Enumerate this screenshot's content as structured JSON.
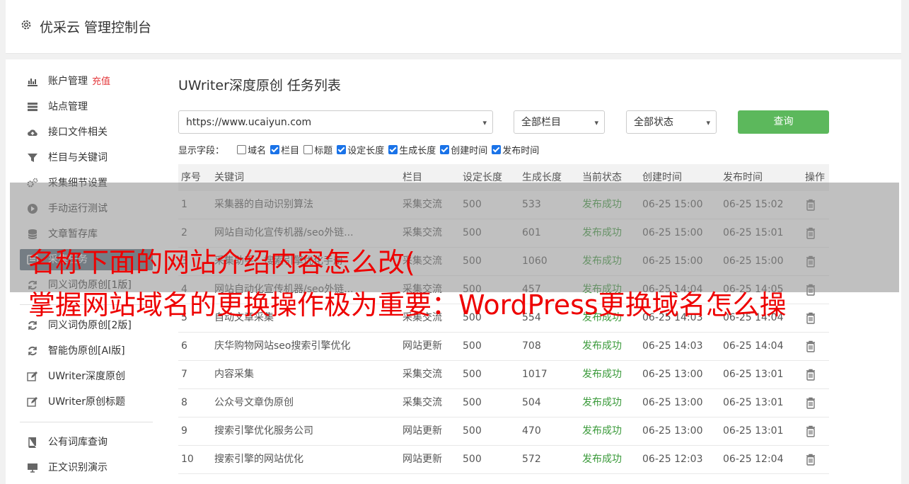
{
  "header": {
    "title": "优采云 管理控制台",
    "icon": "gear-icon"
  },
  "sidebar": {
    "items": [
      {
        "label": "账户管理",
        "extra": "充值",
        "icon": "bar-chart-icon"
      },
      {
        "label": "站点管理",
        "icon": "server-icon"
      },
      {
        "label": "接口文件相关",
        "icon": "cloud-upload-icon"
      },
      {
        "label": "栏目与关键词",
        "icon": "filter-icon"
      },
      {
        "label": "采集细节设置",
        "icon": "gears-icon"
      },
      {
        "label": "手动运行测试",
        "icon": "play-circle-icon"
      },
      {
        "label": "文章暂存库",
        "icon": "database-icon"
      },
      {
        "label": "采集任务",
        "icon": "list-icon",
        "active": true
      },
      {
        "label": "同义词伪原创[1版]",
        "icon": "refresh-icon"
      },
      {
        "label": "同义词伪原创[2版]",
        "icon": "refresh-icon"
      },
      {
        "label": "智能伪原创[AI版]",
        "icon": "refresh-icon"
      },
      {
        "label": "UWriter深度原创",
        "icon": "edit-icon"
      },
      {
        "label": "UWriter原创标题",
        "icon": "edit-icon"
      },
      {
        "label": "公有词库查询",
        "icon": "book-icon"
      },
      {
        "label": "正文识别演示",
        "icon": "monitor-icon"
      }
    ]
  },
  "main": {
    "title": "UWriter深度原创 任务列表",
    "filters": {
      "site": "https://www.ucaiyun.com",
      "column": "全部栏目",
      "status": "全部状态",
      "query_label": "查询"
    },
    "fields": {
      "label": "显示字段：",
      "options": [
        {
          "label": "域名",
          "checked": false
        },
        {
          "label": "栏目",
          "checked": true
        },
        {
          "label": "标题",
          "checked": false
        },
        {
          "label": "设定长度",
          "checked": true
        },
        {
          "label": "生成长度",
          "checked": true
        },
        {
          "label": "创建时间",
          "checked": true
        },
        {
          "label": "发布时间",
          "checked": true
        }
      ]
    },
    "table": {
      "headers": [
        "序号",
        "关键词",
        "栏目",
        "设定长度",
        "生成长度",
        "当前状态",
        "创建时间",
        "发布时间",
        "操作"
      ],
      "rows": [
        [
          "1",
          "采集器的自动识别算法",
          "采集交流",
          "500",
          "533",
          "发布成功",
          "06-25 15:00",
          "06-25 15:02"
        ],
        [
          "2",
          "网站自动化宣传机器/seo外链...",
          "采集交流",
          "500",
          "601",
          "发布成功",
          "06-25 15:00",
          "06-25 15:01"
        ],
        [
          "3",
          "采集助手：搜索引擎优化手册",
          "采集交流",
          "500",
          "1060",
          "发布成功",
          "06-25 15:00",
          "06-25 15:00"
        ],
        [
          "4",
          "网站自动化宣传机器/seo外链...",
          "采集交流",
          "500",
          "457",
          "发布成功",
          "06-25 14:04",
          "06-25 14:05"
        ],
        [
          "5",
          "自动文章采集",
          "采集交流",
          "500",
          "554",
          "发布成功",
          "06-25 14:03",
          "06-25 14:04"
        ],
        [
          "6",
          "庆华购物网站seo搜索引擎优化",
          "网站更新",
          "500",
          "708",
          "发布成功",
          "06-25 14:03",
          "06-25 14:04"
        ],
        [
          "7",
          "内容采集",
          "采集交流",
          "500",
          "1017",
          "发布成功",
          "06-25 13:00",
          "06-25 13:01"
        ],
        [
          "8",
          "公众号文章伪原创",
          "采集交流",
          "500",
          "504",
          "发布成功",
          "06-25 13:00",
          "06-25 13:01"
        ],
        [
          "9",
          "搜索引擎优化服务公司",
          "网站更新",
          "500",
          "470",
          "发布成功",
          "06-25 13:00",
          "06-25 13:01"
        ],
        [
          "10",
          "搜索引擎的网站优化",
          "网站更新",
          "500",
          "572",
          "发布成功",
          "06-25 12:03",
          "06-25 12:04"
        ]
      ]
    }
  },
  "overlay": {
    "line1": "名称下面的网站介绍内容怎么改(",
    "line2": "掌握网站域名的更换操作极为重要：WordPress更换域名怎么操"
  },
  "colors": {
    "accent_green": "#5cb85c",
    "status_green": "#3a9a3a",
    "overlay_red": "#ee0000",
    "recharge_red": "#e4393c"
  }
}
